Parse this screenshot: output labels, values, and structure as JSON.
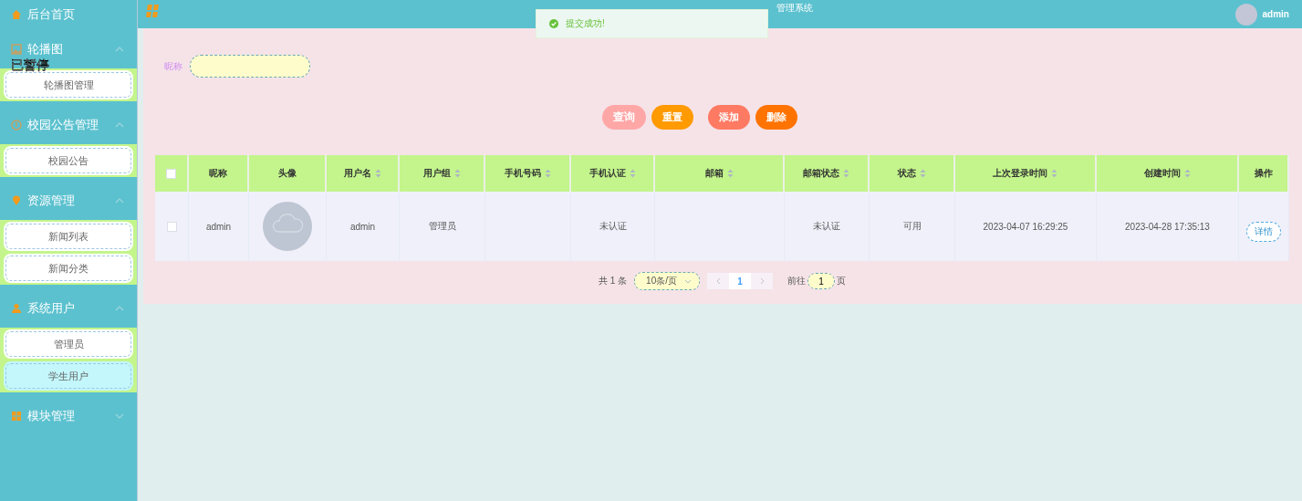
{
  "sidebar": {
    "home": {
      "label": "后台首页"
    },
    "groups": [
      {
        "label": "轮播图",
        "expanded": true,
        "items": [
          {
            "label": "轮播图管理",
            "selected": false
          }
        ]
      },
      {
        "label": "校园公告管理",
        "expanded": true,
        "items": [
          {
            "label": "校园公告",
            "selected": false
          }
        ]
      },
      {
        "label": "资源管理",
        "expanded": true,
        "items": [
          {
            "label": "新闻列表",
            "selected": false
          },
          {
            "label": "新闻分类",
            "selected": false
          }
        ]
      },
      {
        "label": "系统用户",
        "expanded": true,
        "items": [
          {
            "label": "管理员",
            "selected": false
          },
          {
            "label": "学生用户",
            "selected": true
          }
        ]
      },
      {
        "label": "模块管理",
        "expanded": false
      }
    ]
  },
  "paused_overlay": "已暂停",
  "header": {
    "title": "管理系统",
    "user": "admin"
  },
  "toast": {
    "message": "提交成功!"
  },
  "search": {
    "label": "昵称"
  },
  "buttons": [
    {
      "label": "查询",
      "kind": "query"
    },
    {
      "label": "重置",
      "kind": "reset"
    },
    {
      "label": "添加",
      "kind": "add"
    },
    {
      "label": "删除",
      "kind": "delete"
    }
  ],
  "table": {
    "select_all": {
      "checked": false
    },
    "columns": [
      {
        "label": "昵称",
        "sortable": false
      },
      {
        "label": "头像",
        "sortable": false
      },
      {
        "label": "用户名",
        "sortable": true
      },
      {
        "label": "用户组",
        "sortable": true
      },
      {
        "label": "手机号码",
        "sortable": true
      },
      {
        "label": "手机认证",
        "sortable": true
      },
      {
        "label": "邮箱",
        "sortable": true
      },
      {
        "label": "邮箱状态",
        "sortable": true
      },
      {
        "label": "状态",
        "sortable": true
      },
      {
        "label": "上次登录时间",
        "sortable": true
      },
      {
        "label": "创建时间",
        "sortable": true
      },
      {
        "label": "操作",
        "sortable": false
      }
    ],
    "rows": [
      {
        "checked": false,
        "cells": [
          "admin",
          "",
          "admin",
          "管理员",
          "",
          "未认证",
          "",
          "未认证",
          "可用",
          "2023-04-07 16:29:25",
          "2023-04-28 17:35:13",
          "详情"
        ]
      }
    ]
  },
  "pagination": {
    "total": "共 1 条",
    "page_size": "10条/页",
    "current": "1",
    "goto_label": "前往",
    "goto_value": "1",
    "page_suffix": "页"
  }
}
